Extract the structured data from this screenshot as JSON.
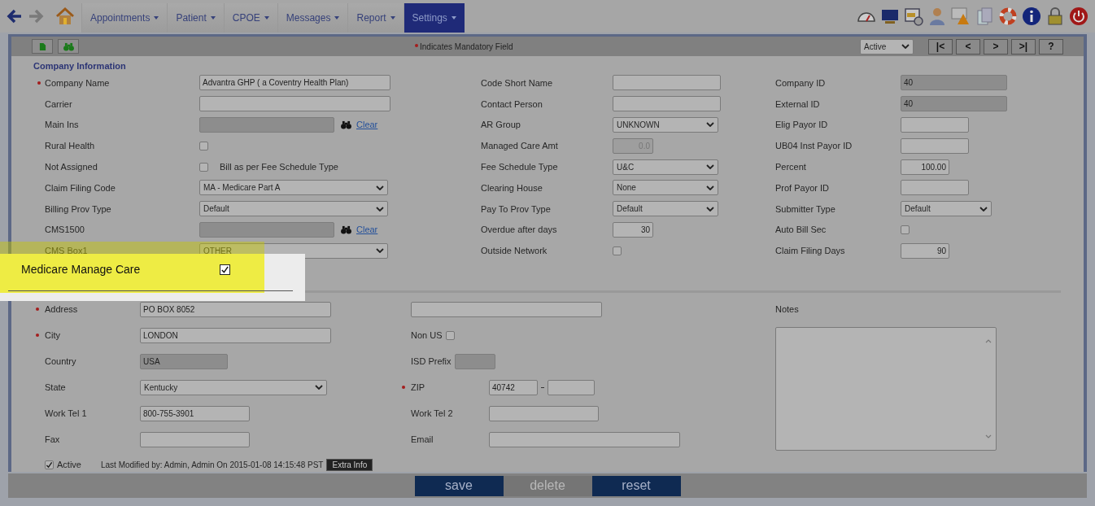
{
  "menus": [
    {
      "label": "Appointments",
      "selected": false
    },
    {
      "label": "Patient",
      "selected": false
    },
    {
      "label": "CPOE",
      "selected": false
    },
    {
      "label": "Messages",
      "selected": false
    },
    {
      "label": "Report",
      "selected": false
    },
    {
      "label": "Settings",
      "selected": true
    }
  ],
  "toolbar": {
    "mandatory_note": "Indicates Mandatory Field",
    "status": "Active",
    "nav_buttons": [
      "|<",
      "<",
      ">",
      ">|",
      "?"
    ]
  },
  "company_info": {
    "title": "Company Information",
    "columns": [
      [
        {
          "label": "Company Name",
          "kind": "text",
          "required": true,
          "value": "Advantra GHP ( a Coventry Health Plan)"
        },
        {
          "label": "Carrier",
          "kind": "text"
        },
        {
          "label": "Main Ins",
          "kind": "lookup",
          "link": "Clear"
        },
        {
          "label": "Rural Health",
          "kind": "checkbox",
          "checked": false
        },
        {
          "label": "Not Assigned",
          "kind": "checkbox",
          "checked": false,
          "note": "Bill as per Fee Schedule Type"
        },
        {
          "label": "Claim Filing Code",
          "kind": "select",
          "value": "MA - Medicare Part A"
        },
        {
          "label": "Billing Prov Type",
          "kind": "select",
          "value": "Default"
        },
        {
          "label": "CMS1500",
          "kind": "lookup",
          "link": "Clear"
        },
        {
          "label": "CMS Box1",
          "kind": "select",
          "value": "OTHER"
        }
      ],
      [
        {
          "label": "Code Short Name",
          "kind": "text"
        },
        {
          "label": "Contact Person",
          "kind": "text"
        },
        {
          "label": "AR Group",
          "kind": "select",
          "value": "UNKNOWN"
        },
        {
          "label": "Managed Care Amt",
          "kind": "number",
          "disabled": true,
          "value": "0.0"
        },
        {
          "label": "Fee Schedule Type",
          "kind": "select",
          "value": "U&C"
        },
        {
          "label": "Clearing House",
          "kind": "select",
          "value": "None"
        },
        {
          "label": "Pay To Prov Type",
          "kind": "select",
          "value": "Default"
        },
        {
          "label": "Overdue after days",
          "kind": "number",
          "disabled": false,
          "value": "30"
        },
        {
          "label": "Outside Network",
          "kind": "checkbox",
          "checked": false
        }
      ],
      [
        {
          "label": "Company ID",
          "kind": "readonly",
          "value": "40"
        },
        {
          "label": "External ID",
          "kind": "readonly",
          "value": "40"
        },
        {
          "label": "Elig Payor ID",
          "kind": "text"
        },
        {
          "label": "UB04 Inst Payor ID",
          "kind": "text"
        },
        {
          "label": "Percent",
          "kind": "number",
          "disabled": false,
          "value": "100.00"
        },
        {
          "label": "Prof Payor ID",
          "kind": "text"
        },
        {
          "label": "Submitter Type",
          "kind": "select",
          "value": "Default"
        },
        {
          "label": "Auto Bill Sec",
          "kind": "checkbox",
          "checked": false
        },
        {
          "label": "Claim Filing Days",
          "kind": "number",
          "disabled": false,
          "value": "90"
        }
      ]
    ]
  },
  "address": {
    "columns": [
      [
        {
          "label": "Address",
          "kind": "text",
          "required": true,
          "value": "PO BOX 8052"
        },
        {
          "label": "City",
          "kind": "text",
          "required": true,
          "value": "LONDON"
        },
        {
          "label": "Country",
          "kind": "readonly",
          "value": "USA"
        },
        {
          "label": "State",
          "kind": "select",
          "value": "Kentucky"
        },
        {
          "label": "Work Tel 1",
          "kind": "tel",
          "value": "800-755-3901"
        },
        {
          "label": "Fax",
          "kind": "tel"
        }
      ],
      [
        {
          "kind": "unlabeled"
        },
        {
          "label": "Non US",
          "kind": "inline_checkbox",
          "checked": false
        },
        {
          "label": "ISD Prefix",
          "kind": "inline_readonly"
        },
        {
          "label": "ZIP",
          "kind": "zip",
          "required": true,
          "value": "40742"
        },
        {
          "label": "Work Tel 2",
          "kind": "tel"
        },
        {
          "label": "Email",
          "kind": "text"
        }
      ]
    ],
    "notes": {
      "label": "Notes"
    }
  },
  "footer": {
    "active": {
      "label": "Active",
      "checked": true
    },
    "last_modified": "Last Modified by: Admin, Admin On 2015-01-08 14:15:48 PST",
    "extra_button": "Extra Info"
  },
  "actions": [
    {
      "label": "save",
      "disabled": false
    },
    {
      "label": "delete",
      "disabled": true
    },
    {
      "label": "reset",
      "disabled": false
    }
  ],
  "callout": {
    "label": "Medicare Manage Care",
    "checked": true
  }
}
